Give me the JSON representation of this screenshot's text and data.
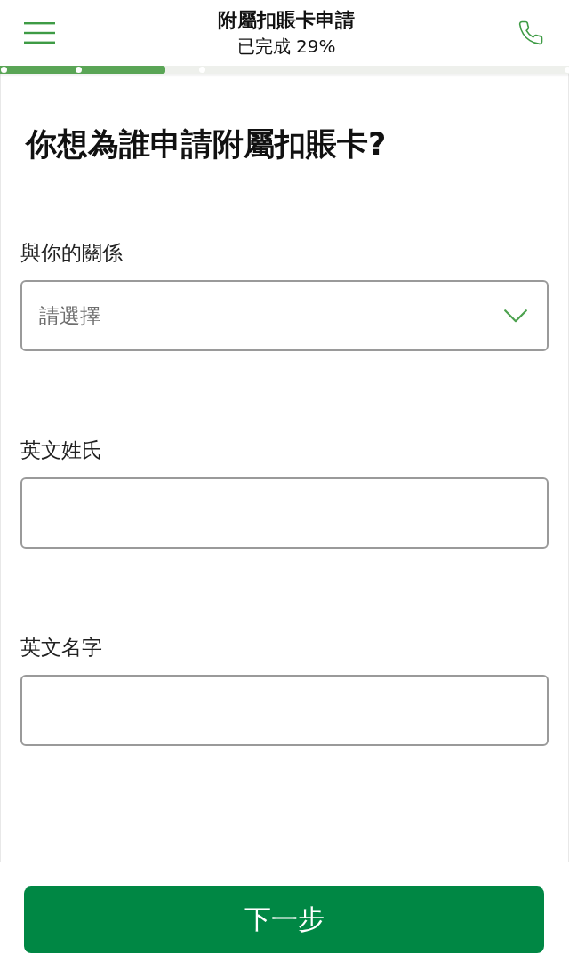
{
  "header": {
    "title": "附屬扣賬卡申請",
    "progress_text": "已完成 29%"
  },
  "progress": {
    "level": 0.29
  },
  "question": "你想為誰申請附屬扣賬卡?",
  "fields": [
    {
      "kind": "select",
      "label": "與你的關係",
      "placeholder": "請選擇"
    },
    {
      "kind": "text",
      "label": "英文姓氏"
    },
    {
      "kind": "text",
      "label": "英文名字"
    }
  ],
  "next_button": "下一步"
}
